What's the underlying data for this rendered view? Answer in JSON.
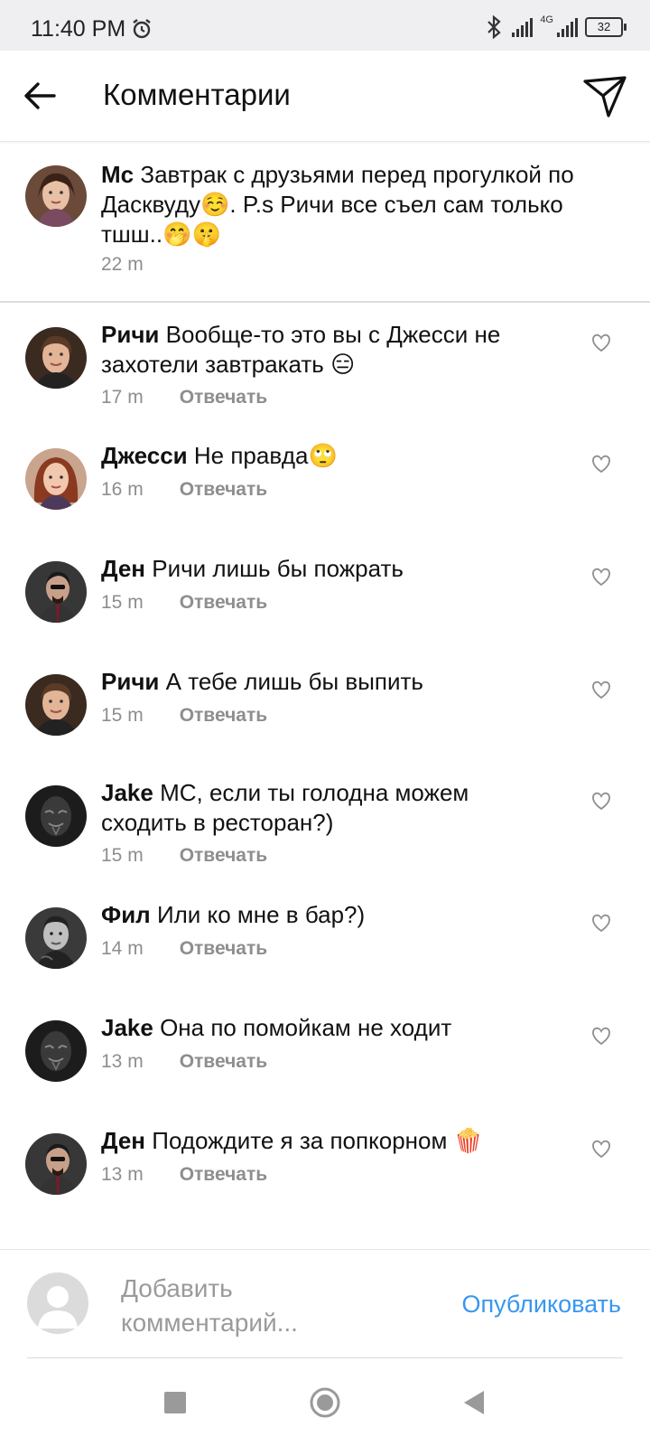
{
  "status": {
    "time": "11:40 PM",
    "network": "4G",
    "battery": "32"
  },
  "header": {
    "title": "Комментарии"
  },
  "caption": {
    "author": "Mc",
    "text": "Завтрак с друзьями перед прогулкой по Дасквуду☺️. P.s Ричи все съел сам только тшш..🤭🤫",
    "time": "22 m"
  },
  "reply_label": "Отвечать",
  "comments": [
    {
      "author": "Ричи",
      "text": "Вообще-то это вы с Джесси не захотели завтракать 😑",
      "time": "17 m",
      "avatar": "richie"
    },
    {
      "author": "Джесси",
      "text": "Не правда🙄",
      "time": "16 m",
      "avatar": "jessy"
    },
    {
      "author": "Ден",
      "text": "Ричи лишь бы пожрать",
      "time": "15 m",
      "avatar": "dan"
    },
    {
      "author": "Ричи",
      "text": "А тебе лишь бы выпить",
      "time": "15 m",
      "avatar": "richie"
    },
    {
      "author": "Jake",
      "text": "MC, если ты голодна можем сходить в ресторан?)",
      "time": "15 m",
      "avatar": "jake"
    },
    {
      "author": "Фил",
      "text": "Или ко мне в бар?)",
      "time": "14 m",
      "avatar": "phil"
    },
    {
      "author": "Jake",
      "text": "Она по помойкам не ходит",
      "time": "13 m",
      "avatar": "jake"
    },
    {
      "author": "Ден",
      "text": "Подождите я за попкорном 🍿",
      "time": "13 m",
      "avatar": "dan"
    }
  ],
  "composer": {
    "placeholder": "Добавить комментарий...",
    "publish": "Опубликовать"
  },
  "colors": {
    "accent": "#3897f0",
    "meta": "#8e8e8e"
  }
}
